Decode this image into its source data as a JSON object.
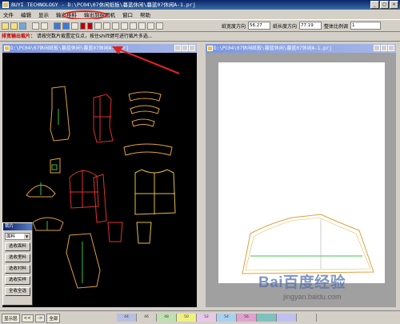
{
  "window": {
    "title": "BUYI TECHNOLOGY - D:\\PC04\\07休闲纸板\\暮蓝休闲\\暮蓝07休闲A-1.prj",
    "controls": [
      "_",
      "□",
      "×"
    ]
  },
  "menu": {
    "items": [
      "文件",
      "编辑",
      "显示",
      "输出排料",
      "输出到绘图机",
      "窗口",
      "帮助"
    ]
  },
  "toolbar": {
    "width_label": "纸宽度方向",
    "width_value": "56.27",
    "length_label": "纸长度方向",
    "length_value": "77.19",
    "scale_label": "整体比例调",
    "scale_value": "1"
  },
  "hint": {
    "label": "排宽输出裁片：",
    "text": "请按完数片裁置定位点，按住shift键可进行裁片多选..."
  },
  "left_panel": {
    "title": "D:\\PC04\\07休闲纸板\\暮蓝休闲\\暮蓝07休闲A-1.prj"
  },
  "right_panel": {
    "title": "D:\\PC04\\07休闲纸板\\暮蓝休闲\\暮蓝07休闲A-1.prj"
  },
  "float_panel": {
    "title": "裁片",
    "select_value": "面料",
    "buttons": [
      "选收面料",
      "选收里料",
      "选收衬料",
      "选收实样",
      "全收全选"
    ]
  },
  "statusbar": {
    "items": [
      "显示层",
      "<<",
      "->",
      "全部"
    ],
    "swatches": [
      {
        "label": "44",
        "color": "#b8c0e0"
      },
      {
        "label": "46",
        "color": "#d4d0c8"
      },
      {
        "label": "48",
        "color": "#c0e0b0"
      },
      {
        "label": "50",
        "color": "#f0f080"
      },
      {
        "label": "52",
        "color": "#e8c8e8"
      },
      {
        "label": "54",
        "color": "#a8d0f0"
      },
      {
        "label": "56",
        "color": "#e0a0d0"
      },
      {
        "label": "",
        "color": "#80c0c0"
      },
      {
        "label": "",
        "color": "#c0c0f0"
      },
      {
        "label": "",
        "color": "#d4d0c8"
      }
    ]
  },
  "watermark": {
    "brand": "Bai百度经验",
    "url": "jingyan.baidu.com"
  },
  "colors": {
    "pattern_orange": "#e0a040",
    "pattern_red": "#e03030",
    "pattern_green": "#40c040",
    "annotation_red": "#e02020"
  }
}
